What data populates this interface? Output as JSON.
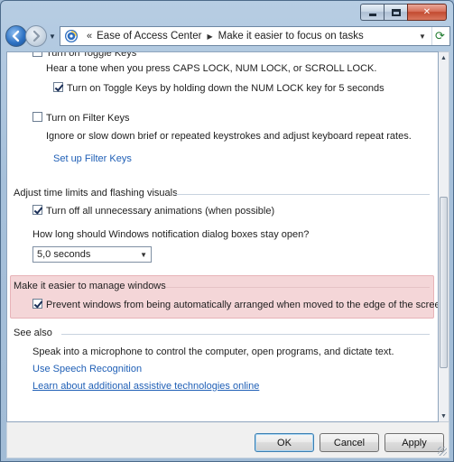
{
  "window": {
    "caption_buttons": [
      "minimize",
      "maximize",
      "close"
    ],
    "close_glyph": "✕"
  },
  "address": {
    "prefix": "«",
    "crumbs": [
      "Ease of Access Center",
      "Make it easier to focus on tasks"
    ],
    "refresh_glyph": "⟳"
  },
  "content": {
    "toggle_keys_cb_label": "Turn on Toggle Keys",
    "toggle_tone_text": "Hear a tone when you press CAPS LOCK, NUM LOCK, or SCROLL LOCK.",
    "toggle_hold_label": "Turn on Toggle Keys by holding down the NUM LOCK key for 5 seconds",
    "filter_keys_label": "Turn on Filter Keys",
    "filter_desc": "Ignore or slow down brief or repeated keystrokes and adjust keyboard repeat rates.",
    "filter_link": "Set up Filter Keys",
    "time_section": "Adjust time limits and flashing visuals",
    "animations_label": "Turn off all unnecessary animations (when possible)",
    "notification_question": "How long should Windows notification dialog boxes stay open?",
    "notification_value": "5,0 seconds",
    "windows_section": "Make it easier to manage windows",
    "prevent_arrange_label": "Prevent windows from being automatically arranged when moved to the edge of the screen",
    "see_also": "See also",
    "speech_desc": "Speak into a microphone to control the computer, open programs, and dictate text.",
    "speech_link": "Use Speech Recognition",
    "assistive_link": "Learn about additional assistive technologies online"
  },
  "buttons": {
    "ok": "OK",
    "cancel": "Cancel",
    "apply": "Apply"
  },
  "colors": {
    "highlight": "#f4d6d8",
    "link": "#1f5fb6"
  }
}
